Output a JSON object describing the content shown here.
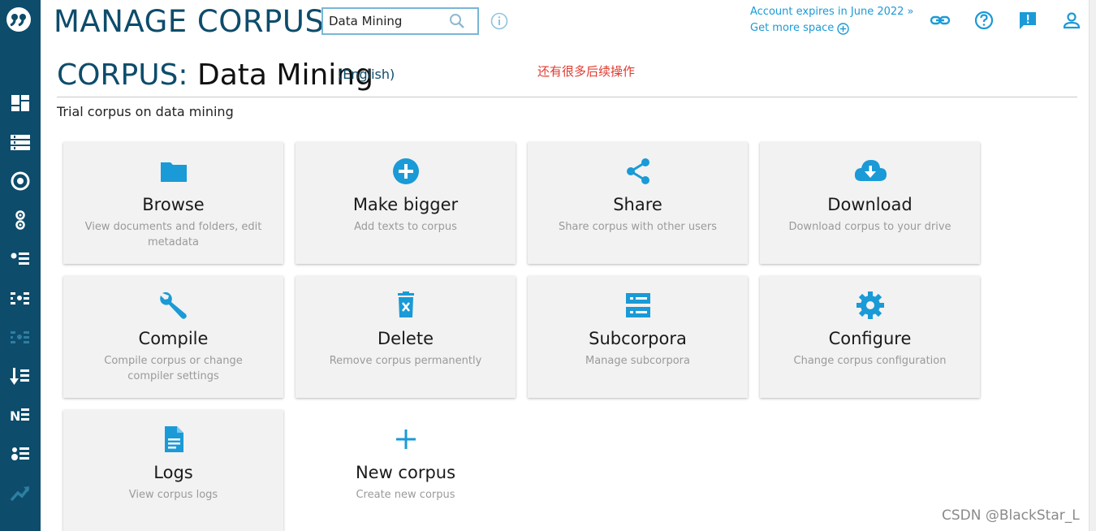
{
  "header": {
    "app_title": "MANAGE CORPUS",
    "search_value": "Data Mining",
    "account_expires": "Account expires in June 2022 »",
    "get_more_space": "Get more space"
  },
  "corpus": {
    "prefix": "CORPUS:",
    "name": "Data Mining",
    "language": "(English)",
    "description": "Trial corpus on data mining",
    "note": "还有很多后续操作"
  },
  "cards": [
    {
      "title": "Browse",
      "desc": "View documents and folders, edit metadata",
      "icon": "folder-icon"
    },
    {
      "title": "Make bigger",
      "desc": "Add texts to corpus",
      "icon": "plus-circle-icon"
    },
    {
      "title": "Share",
      "desc": "Share corpus with other users",
      "icon": "share-icon"
    },
    {
      "title": "Download",
      "desc": "Download corpus to your drive",
      "icon": "cloud-download-icon"
    },
    {
      "title": "Compile",
      "desc": "Compile corpus or change compiler settings",
      "icon": "wrench-icon"
    },
    {
      "title": "Delete",
      "desc": "Remove corpus permanently",
      "icon": "trash-icon"
    },
    {
      "title": "Subcorpora",
      "desc": "Manage subcorpora",
      "icon": "subcorpora-icon"
    },
    {
      "title": "Configure",
      "desc": "Change corpus configuration",
      "icon": "gear-icon"
    },
    {
      "title": "Logs",
      "desc": "View corpus logs",
      "icon": "document-icon"
    },
    {
      "title": "New corpus",
      "desc": "Create new corpus",
      "icon": "plus-icon"
    }
  ],
  "sidebar_icons": [
    "dashboard-icon",
    "list-icon",
    "concordance-icon",
    "parallel-icon",
    "wordlist-icon",
    "wordsketch-icon",
    "thesaurus-icon",
    "keywords-icon",
    "ngrams-icon",
    "ne-icon",
    "trends-icon"
  ],
  "watermark": "CSDN @BlackStar_L",
  "colors": {
    "sidebar": "#0d4c6b",
    "accent": "#1a9ad6",
    "title": "#0d4c6b",
    "note": "#e03a2f",
    "card_bg": "#f2f2f2"
  }
}
